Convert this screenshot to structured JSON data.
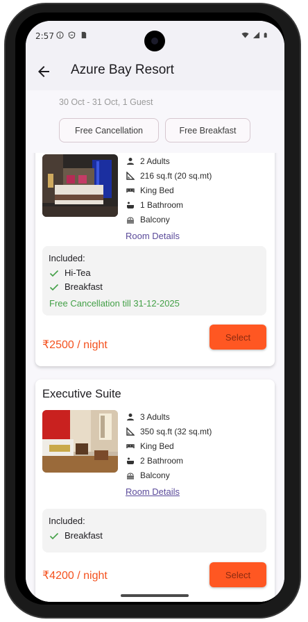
{
  "status_bar": {
    "time": "2:57",
    "left_icons": [
      "info-icon",
      "shield-icon",
      "sim-icon"
    ],
    "right_icons": [
      "wifi-icon",
      "signal-icon",
      "battery-icon"
    ]
  },
  "app_bar": {
    "back_icon": "arrow-back-icon",
    "title": "Azure Bay Resort"
  },
  "booking": {
    "dates_guests": "30 Oct - 31 Oct, 1 Guest"
  },
  "filters": [
    {
      "label": "Free Cancellation"
    },
    {
      "label": "Free Breakfast"
    }
  ],
  "rooms": [
    {
      "name": "",
      "features": [
        {
          "icon": "person-icon",
          "text": "2 Adults"
        },
        {
          "icon": "area-icon",
          "text": "216 sq.ft (20 sq.mt)"
        },
        {
          "icon": "bed-icon",
          "text": "King Bed"
        },
        {
          "icon": "bathtub-icon",
          "text": "1 Bathroom"
        },
        {
          "icon": "balcony-icon",
          "text": "Balcony"
        }
      ],
      "details_link": "Room Details",
      "included_title": "Included:",
      "included": [
        "Hi-Tea",
        "Breakfast"
      ],
      "cancellation": "Free Cancellation till 31-12-2025",
      "price": "₹2500 / night",
      "select_label": "Select"
    },
    {
      "name": "Executive Suite",
      "features": [
        {
          "icon": "person-icon",
          "text": "3 Adults"
        },
        {
          "icon": "area-icon",
          "text": "350 sq.ft (32 sq.mt)"
        },
        {
          "icon": "bed-icon",
          "text": "King Bed"
        },
        {
          "icon": "bathtub-icon",
          "text": "2 Bathroom"
        },
        {
          "icon": "balcony-icon",
          "text": "Balcony"
        }
      ],
      "details_link": "Room Details",
      "included_title": "Included:",
      "included": [
        "Breakfast"
      ],
      "price": "₹4200 / night",
      "select_label": "Select"
    }
  ],
  "colors": {
    "accent_orange": "#ff5722",
    "price_orange": "#f4511e",
    "success_green": "#43a047",
    "link_purple": "#5a4a9a"
  }
}
